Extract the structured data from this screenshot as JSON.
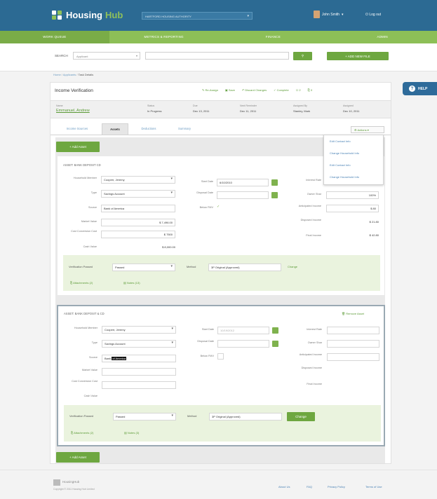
{
  "app": {
    "logo_left": "Housing",
    "logo_right": "Hub",
    "authority": "HARTFORD HOUSING AUTHORITY",
    "user": "John Smith",
    "logout": "Log out"
  },
  "nav": [
    "WORK QUEUE",
    "METRICS & REPORTING",
    "FINANCE",
    "ADMIN"
  ],
  "search": {
    "label": "SEARCH",
    "select_value": "Applicant",
    "input_placeholder": "",
    "add_button": "+ ADD NEW FILE"
  },
  "breadcrumb": {
    "home": "Home",
    "sep1": "/",
    "section": "Applicants",
    "sep2": "/",
    "current": "Task Details"
  },
  "help": "HELP",
  "task": {
    "title": "Income Verification",
    "actions": [
      "Re-Assign",
      "Save",
      "Discard Changes",
      "Complete"
    ],
    "counts": [
      "2",
      "0"
    ],
    "cols": [
      {
        "label": "Name",
        "value": "Emmanuel, Andrew"
      },
      {
        "label": "Status",
        "value": "In Progress"
      },
      {
        "label": "Due",
        "value": "Dec 13, 2011"
      },
      {
        "label": "Next Reminder",
        "value": "Dec 11, 2011"
      },
      {
        "label": "Assigned By",
        "value": "Stanley, Mark"
      },
      {
        "label": "Assigned",
        "value": "Dec 10, 2011"
      }
    ]
  },
  "tabs": [
    "Income Sources",
    "Assets",
    "Deductions",
    "Summary"
  ],
  "actions_menu": {
    "label": "Actions",
    "items": [
      "Edit Contact Info",
      "Change Household Info",
      "Edit Contact Info",
      "Change Household Info"
    ]
  },
  "add_asset": "+ Add Asset",
  "asset1": {
    "title": "ASSET: BANK DEPOSIT CD",
    "household_member_label": "Household Member",
    "household_member": "Cooperr, Jeremy",
    "type_label": "Type",
    "type": "Savings Account",
    "source_label": "Source",
    "source": "Bank of America",
    "market_value_label": "Market Value",
    "market_value": "$ 7,496.00",
    "cost_label": "Cost Conversion Cost",
    "cost": "$ 7500",
    "cash_value_label": "Cash Value",
    "cash_value": "$ 8,000.00",
    "start_date_label": "Start Date",
    "start_date": "6/10/2010",
    "disposal_label": "Disposal Date",
    "disposal": "",
    "below_fmv_label": "Below FMV",
    "interest_label": "Interest Rate",
    "interest": "",
    "owner_share_label": "Owner Shar",
    "owner_share": "100%",
    "anticipated_label": "Anticipated Income",
    "anticipated": "$ 80",
    "disposed_label": "Disposed Income",
    "disposed": "$ 21.80",
    "final_label": "Final Income",
    "final": "$ 42.80",
    "verification_label": "Verification Passed",
    "verification": "Passed",
    "method_label": "Method",
    "method": "3P Original (Approved)",
    "change": "Change",
    "attachments": "Attachments (2)",
    "notes": "Notes (13)"
  },
  "asset2": {
    "title": "ASSET: BANK DEPOSIT & CD",
    "remove": "Remove Asset",
    "household_member": "Cooperr, Jeremy",
    "type": "Savings Account",
    "source_prefix": "Bank",
    "source_selected": "of America",
    "start_date": "10/19/2012",
    "verification": "Passed",
    "method": "3P Original (Approved)",
    "change": "Change",
    "attachments": "Attachments (2)",
    "notes": "Notes (3)"
  },
  "add_asset_bottom": "+ Add Asset",
  "footer": {
    "brand": "HousingHub",
    "copyright": "Copyright © 2011 Housing Hub Limited",
    "links": [
      "About Us",
      "FAQ",
      "Privacy Policy",
      "Terms of Use"
    ]
  }
}
